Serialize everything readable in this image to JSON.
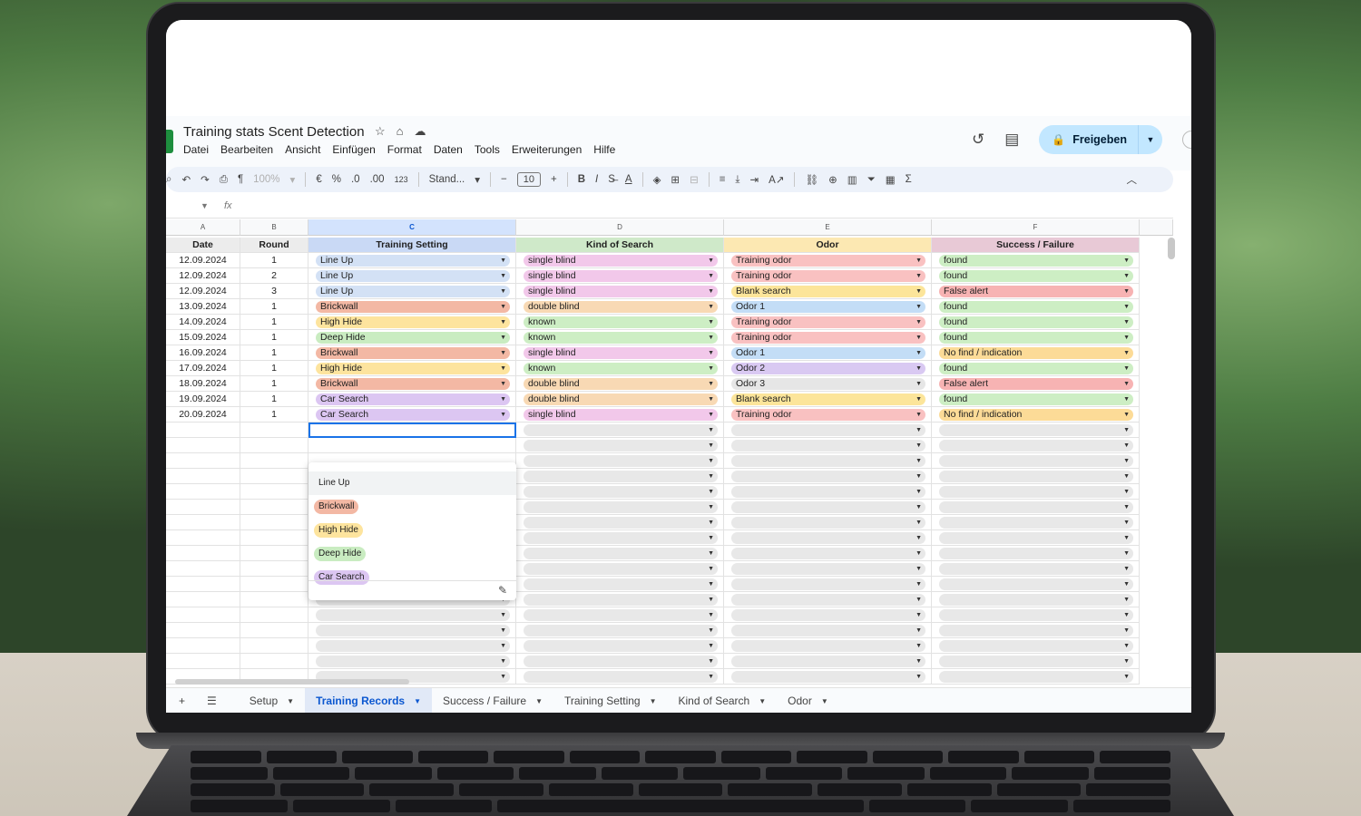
{
  "doc": {
    "title": "Training stats Scent Detection",
    "menu": [
      "Datei",
      "Bearbeiten",
      "Ansicht",
      "Einfügen",
      "Format",
      "Daten",
      "Tools",
      "Erweiterungen",
      "Hilfe"
    ],
    "share_label": "Freigeben"
  },
  "toolbar": {
    "zoom": "100%",
    "currency": "€",
    "percent": "%",
    "dec_decrease": ".0",
    "dec_increase": ".00",
    "format_123": "123",
    "font": "Stand...",
    "font_size": "10",
    "bold": "B",
    "italic": "I",
    "sum": "Σ"
  },
  "formula_bar": {
    "fx": "fx"
  },
  "grid": {
    "column_letters": [
      "A",
      "B",
      "C",
      "D",
      "E",
      "F"
    ],
    "headers": [
      "Date",
      "Round",
      "Training Setting",
      "Kind of Search",
      "Odor",
      "Success / Failure"
    ],
    "rows": [
      [
        "12.09.2024",
        "1",
        "Line Up",
        "single blind",
        "Training odor",
        "found"
      ],
      [
        "12.09.2024",
        "2",
        "Line Up",
        "single blind",
        "Training odor",
        "found"
      ],
      [
        "12.09.2024",
        "3",
        "Line Up",
        "single blind",
        "Blank search",
        "False alert"
      ],
      [
        "13.09.2024",
        "1",
        "Brickwall",
        "double blind",
        "Odor 1",
        "found"
      ],
      [
        "14.09.2024",
        "1",
        "High Hide",
        "known",
        "Training odor",
        "found"
      ],
      [
        "15.09.2024",
        "1",
        "Deep Hide",
        "known",
        "Training odor",
        "found"
      ],
      [
        "16.09.2024",
        "1",
        "Brickwall",
        "single blind",
        "Odor 1",
        "No find / indication"
      ],
      [
        "17.09.2024",
        "1",
        "High Hide",
        "known",
        "Odor 2",
        "found"
      ],
      [
        "18.09.2024",
        "1",
        "Brickwall",
        "double blind",
        "Odor 3",
        "False alert"
      ],
      [
        "19.09.2024",
        "1",
        "Car Search",
        "double blind",
        "Blank search",
        "found"
      ],
      [
        "20.09.2024",
        "1",
        "Car Search",
        "single blind",
        "Training odor",
        "No find / indication"
      ]
    ],
    "chip_colors": {
      "Line Up": "#d3e1f5",
      "Brickwall": "#f3b8a4",
      "High Hide": "#fde49e",
      "Deep Hide": "#c9ecc1",
      "Car Search": "#dcc6f2",
      "single blind": "#f2c8ea",
      "double blind": "#f8d9b4",
      "known": "#cdeec4",
      "Training odor": "#f9c1c1",
      "Blank search": "#fce59a",
      "Odor 1": "#c3ddf6",
      "Odor 2": "#d9c9f2",
      "Odor 3": "#e6e6e6",
      "found": "#cdeec4",
      "False alert": "#f7b3b3",
      "No find / indication": "#fcdb97"
    }
  },
  "dropdown": {
    "options": [
      "Line Up",
      "Brickwall",
      "High Hide",
      "Deep Hide",
      "Car Search"
    ]
  },
  "tabs": {
    "items": [
      "Setup",
      "Training Records",
      "Success / Failure",
      "Training Setting",
      "Kind of Search",
      "Odor"
    ],
    "active": "Training Records"
  }
}
